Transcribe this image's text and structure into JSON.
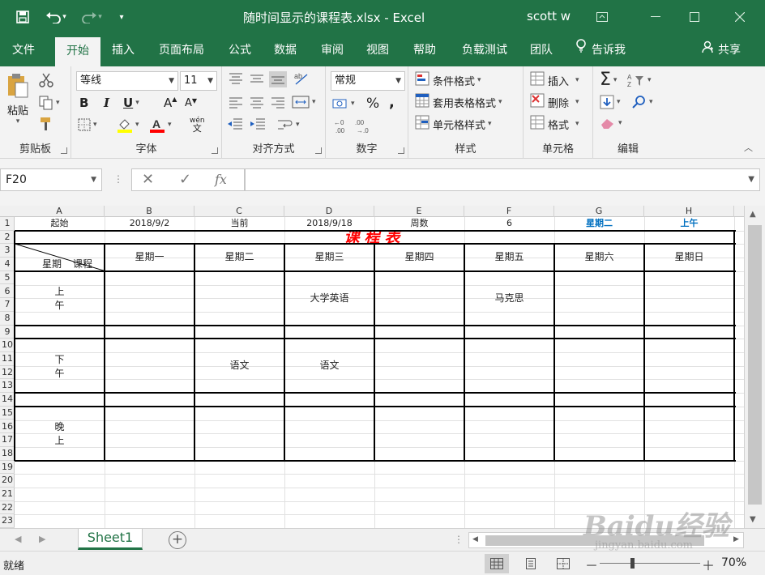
{
  "titlebar": {
    "title": "随时间显示的课程表.xlsx - Excel",
    "user": "scott w",
    "save_icon": "save-icon",
    "undo_icon": "undo-icon",
    "redo_icon": "redo-icon",
    "customize_icon": "customize-quick-access-icon"
  },
  "ribbon_tabs": [
    "文件",
    "开始",
    "插入",
    "页面布局",
    "公式",
    "数据",
    "审阅",
    "视图",
    "帮助",
    "负载测试",
    "团队"
  ],
  "ribbon_active_tab": "开始",
  "tell_me": "告诉我",
  "share": "共享",
  "ribbon": {
    "clipboard": {
      "label": "剪贴板",
      "paste": "粘贴"
    },
    "font": {
      "label": "字体",
      "font_name": "等线",
      "font_size": "11",
      "bold": "B",
      "italic": "I",
      "underline": "U",
      "grow": "A",
      "shrink": "A",
      "phonetic": "wén"
    },
    "alignment": {
      "label": "对齐方式"
    },
    "number": {
      "label": "数字",
      "format": "常规",
      "percent": "%",
      "comma": ","
    },
    "styles": {
      "label": "样式",
      "conditional": "条件格式",
      "table": "套用表格格式",
      "cell_styles": "单元格样式"
    },
    "cells": {
      "label": "单元格",
      "insert": "插入",
      "delete": "删除",
      "format": "格式"
    },
    "editing": {
      "label": "编辑"
    }
  },
  "formula_bar": {
    "name_box": "F20",
    "formula": "",
    "fx": "fx"
  },
  "columns": [
    "A",
    "B",
    "C",
    "D",
    "E",
    "F",
    "G",
    "H"
  ],
  "rows": [
    "1",
    "2",
    "3",
    "4",
    "5",
    "6",
    "7",
    "8",
    "9",
    "10",
    "11",
    "12",
    "13",
    "14",
    "15",
    "16",
    "17",
    "18",
    "19",
    "20",
    "21",
    "22",
    "23"
  ],
  "row1": {
    "a": "起始",
    "b": "2018/9/2",
    "c": "当前",
    "d": "2018/9/18",
    "e": "周数",
    "f": "6",
    "g": "星期二",
    "h": "上午"
  },
  "schedule": {
    "title": "课程表",
    "corner_left": "星期",
    "corner_right": "课程",
    "days": [
      "星期一",
      "星期二",
      "星期三",
      "星期四",
      "星期五",
      "星期六",
      "星期日"
    ],
    "periods": [
      {
        "label_line1": "上",
        "label_line2": "午",
        "cells": [
          "",
          "",
          "大学英语",
          "",
          "马克思",
          "",
          ""
        ]
      },
      {
        "label_line1": "下",
        "label_line2": "午",
        "cells": [
          "",
          "语文",
          "语文",
          "",
          "",
          "",
          ""
        ]
      },
      {
        "label_line1": "晚",
        "label_line2": "上",
        "cells": [
          "",
          "",
          "",
          "",
          "",
          "",
          ""
        ]
      }
    ]
  },
  "sheet_tabs": [
    "Sheet1"
  ],
  "status": {
    "ready": "就绪",
    "zoom": "70%",
    "zoom_minus": "－",
    "zoom_plus": "＋"
  },
  "watermark": {
    "brand": "Baidu经验",
    "url": "jingyan.baidu.com"
  },
  "colors": {
    "excel_green": "#217346",
    "accent_blue": "#0070c0",
    "title_red": "#ff0000"
  }
}
